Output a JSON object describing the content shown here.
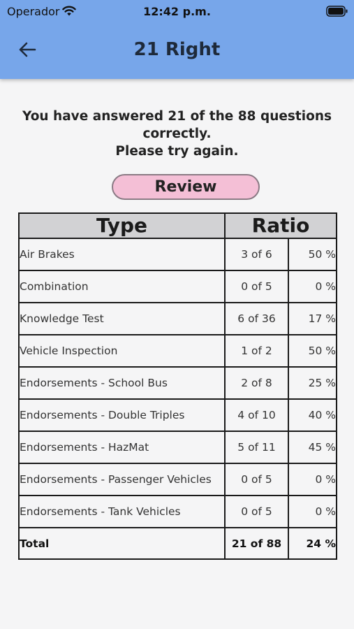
{
  "status_bar": {
    "carrier": "Operador",
    "time": "12:42 p.m."
  },
  "header": {
    "title": "21 Right",
    "back_icon": "arrow-left-icon",
    "color": "#77a6ea"
  },
  "result": {
    "line1": "You have answered 21 of the 88 questions",
    "line2": "correctly.",
    "line3": "Please try again."
  },
  "review_button": {
    "label": "Review",
    "color": "#f4bfd6"
  },
  "table": {
    "headers": {
      "type": "Type",
      "ratio": "Ratio"
    },
    "rows": [
      {
        "type": "Air Brakes",
        "count": "3 of 6",
        "percent": "50 %"
      },
      {
        "type": "Combination",
        "count": "0 of 5",
        "percent": "0 %"
      },
      {
        "type": "Knowledge Test",
        "count": "6 of 36",
        "percent": "17 %"
      },
      {
        "type": "Vehicle Inspection",
        "count": "1 of 2",
        "percent": "50 %"
      },
      {
        "type": "Endorsements - School Bus",
        "count": "2 of 8",
        "percent": "25 %"
      },
      {
        "type": "Endorsements - Double Triples",
        "count": "4 of 10",
        "percent": "40 %"
      },
      {
        "type": "Endorsements - HazMat",
        "count": "5 of 11",
        "percent": "45 %"
      },
      {
        "type": "Endorsements - Passenger Vehicles",
        "count": "0 of 5",
        "percent": "0 %"
      },
      {
        "type": "Endorsements - Tank Vehicles",
        "count": "0 of 5",
        "percent": "0 %"
      }
    ],
    "total": {
      "label": "Total",
      "count": "21 of 88",
      "percent": "24 %"
    }
  }
}
